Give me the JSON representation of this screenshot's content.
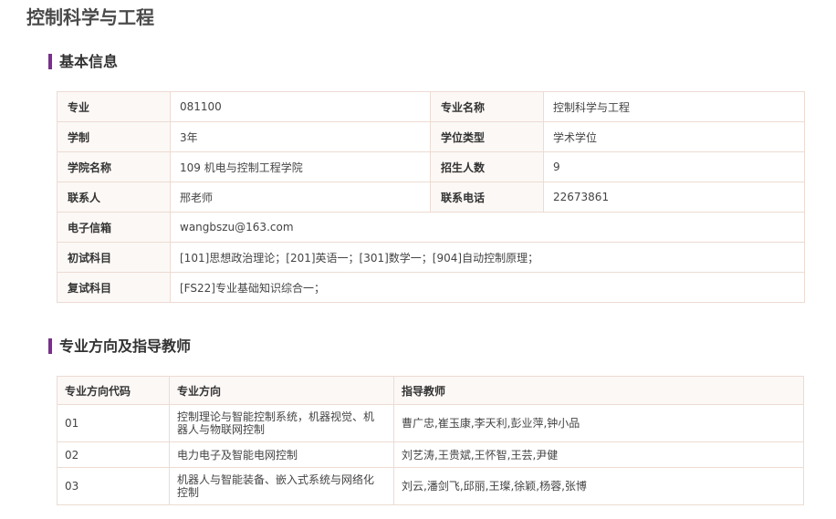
{
  "page_title": "控制科学与工程",
  "sections": {
    "basic_info": "基本信息",
    "directions": "专业方向及指导教师"
  },
  "info": {
    "major_label": "专业",
    "major_value": "081100",
    "major_name_label": "专业名称",
    "major_name_value": "控制科学与工程",
    "duration_label": "学制",
    "duration_value": "3年",
    "degree_type_label": "学位类型",
    "degree_type_value": "学术学位",
    "college_label": "学院名称",
    "college_value": "109 机电与控制工程学院",
    "enroll_label": "招生人数",
    "enroll_value": "9",
    "contact_label": "联系人",
    "contact_value": "邢老师",
    "phone_label": "联系电话",
    "phone_value": "22673861",
    "email_label": "电子信箱",
    "email_value": "wangbszu@163.com",
    "initial_exam_label": "初试科目",
    "initial_exam_value": "[101]思想政治理论；[201]英语一；[301]数学一；[904]自动控制原理；",
    "retest_label": "复试科目",
    "retest_value": "[FS22]专业基础知识综合一；"
  },
  "directions_table": {
    "headers": [
      "专业方向代码",
      "专业方向",
      "指导教师"
    ],
    "rows": [
      {
        "code": "01",
        "direction": "控制理论与智能控制系统，机器视觉、机器人与物联网控制",
        "advisors": "曹广忠,崔玉康,李天利,彭业萍,钟小品"
      },
      {
        "code": "02",
        "direction": "电力电子及智能电网控制",
        "advisors": "刘艺涛,王贵斌,王怀智,王芸,尹健"
      },
      {
        "code": "03",
        "direction": "机器人与智能装备、嵌入式系统与网络化控制",
        "advisors": "刘云,潘剑飞,邱丽,王璨,徐颖,杨蓉,张博"
      }
    ]
  },
  "colors": {
    "accent_bar": "#7b2f8e",
    "link_text": "#a77bc9",
    "label_bg": "#fcf8f6",
    "border": "#ecdcd2"
  }
}
